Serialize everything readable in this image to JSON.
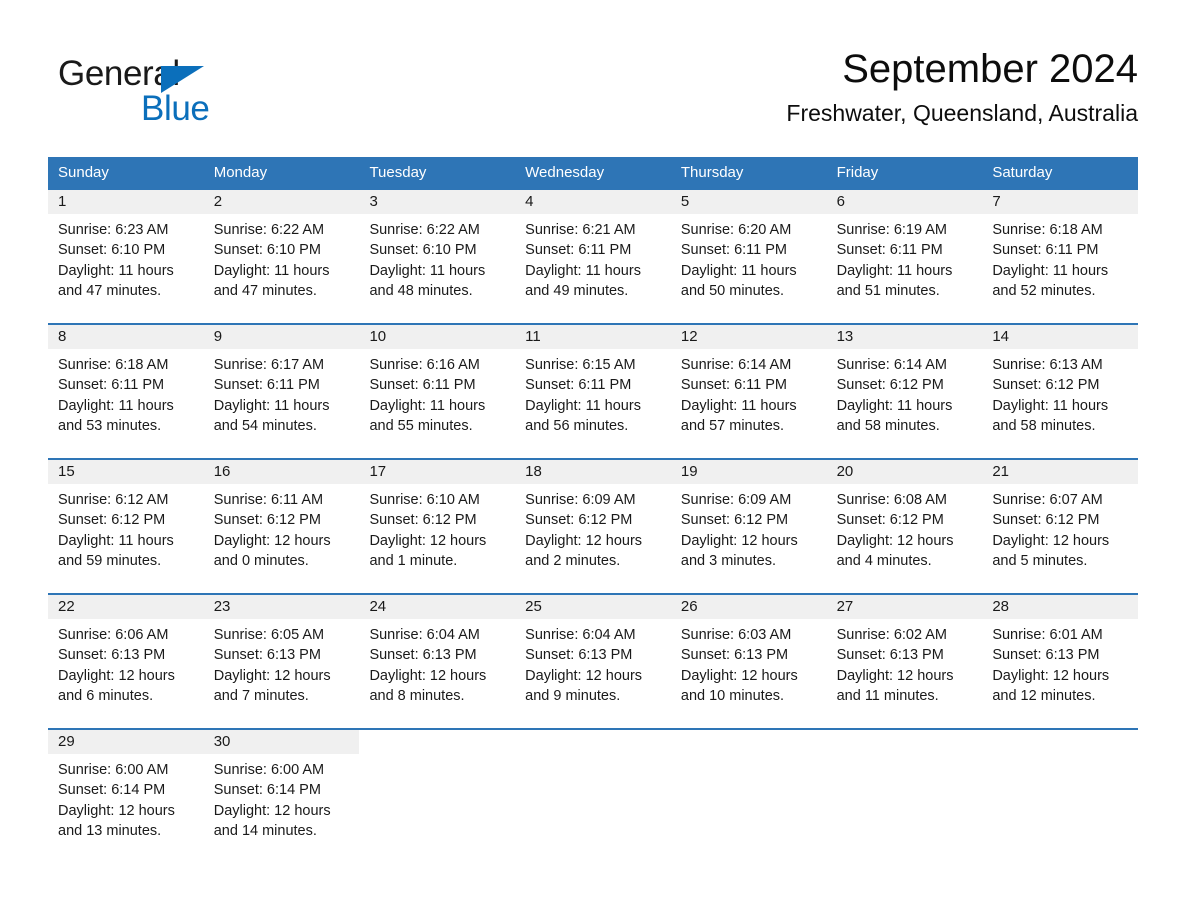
{
  "brand": {
    "name_part1": "General",
    "name_part2": "Blue",
    "triangle_color": "#0B6FBB"
  },
  "header": {
    "title": "September 2024",
    "subtitle": "Freshwater, Queensland, Australia"
  },
  "theme": {
    "header_blue": "#2E75B6",
    "daynum_band": "#F0F0F0",
    "text": "#1a1a1a"
  },
  "weekdays": [
    "Sunday",
    "Monday",
    "Tuesday",
    "Wednesday",
    "Thursday",
    "Friday",
    "Saturday"
  ],
  "weeks": [
    [
      {
        "day": "1",
        "sunrise": "Sunrise: 6:23 AM",
        "sunset": "Sunset: 6:10 PM",
        "daylight_1": "Daylight: 11 hours",
        "daylight_2": "and 47 minutes."
      },
      {
        "day": "2",
        "sunrise": "Sunrise: 6:22 AM",
        "sunset": "Sunset: 6:10 PM",
        "daylight_1": "Daylight: 11 hours",
        "daylight_2": "and 47 minutes."
      },
      {
        "day": "3",
        "sunrise": "Sunrise: 6:22 AM",
        "sunset": "Sunset: 6:10 PM",
        "daylight_1": "Daylight: 11 hours",
        "daylight_2": "and 48 minutes."
      },
      {
        "day": "4",
        "sunrise": "Sunrise: 6:21 AM",
        "sunset": "Sunset: 6:11 PM",
        "daylight_1": "Daylight: 11 hours",
        "daylight_2": "and 49 minutes."
      },
      {
        "day": "5",
        "sunrise": "Sunrise: 6:20 AM",
        "sunset": "Sunset: 6:11 PM",
        "daylight_1": "Daylight: 11 hours",
        "daylight_2": "and 50 minutes."
      },
      {
        "day": "6",
        "sunrise": "Sunrise: 6:19 AM",
        "sunset": "Sunset: 6:11 PM",
        "daylight_1": "Daylight: 11 hours",
        "daylight_2": "and 51 minutes."
      },
      {
        "day": "7",
        "sunrise": "Sunrise: 6:18 AM",
        "sunset": "Sunset: 6:11 PM",
        "daylight_1": "Daylight: 11 hours",
        "daylight_2": "and 52 minutes."
      }
    ],
    [
      {
        "day": "8",
        "sunrise": "Sunrise: 6:18 AM",
        "sunset": "Sunset: 6:11 PM",
        "daylight_1": "Daylight: 11 hours",
        "daylight_2": "and 53 minutes."
      },
      {
        "day": "9",
        "sunrise": "Sunrise: 6:17 AM",
        "sunset": "Sunset: 6:11 PM",
        "daylight_1": "Daylight: 11 hours",
        "daylight_2": "and 54 minutes."
      },
      {
        "day": "10",
        "sunrise": "Sunrise: 6:16 AM",
        "sunset": "Sunset: 6:11 PM",
        "daylight_1": "Daylight: 11 hours",
        "daylight_2": "and 55 minutes."
      },
      {
        "day": "11",
        "sunrise": "Sunrise: 6:15 AM",
        "sunset": "Sunset: 6:11 PM",
        "daylight_1": "Daylight: 11 hours",
        "daylight_2": "and 56 minutes."
      },
      {
        "day": "12",
        "sunrise": "Sunrise: 6:14 AM",
        "sunset": "Sunset: 6:11 PM",
        "daylight_1": "Daylight: 11 hours",
        "daylight_2": "and 57 minutes."
      },
      {
        "day": "13",
        "sunrise": "Sunrise: 6:14 AM",
        "sunset": "Sunset: 6:12 PM",
        "daylight_1": "Daylight: 11 hours",
        "daylight_2": "and 58 minutes."
      },
      {
        "day": "14",
        "sunrise": "Sunrise: 6:13 AM",
        "sunset": "Sunset: 6:12 PM",
        "daylight_1": "Daylight: 11 hours",
        "daylight_2": "and 58 minutes."
      }
    ],
    [
      {
        "day": "15",
        "sunrise": "Sunrise: 6:12 AM",
        "sunset": "Sunset: 6:12 PM",
        "daylight_1": "Daylight: 11 hours",
        "daylight_2": "and 59 minutes."
      },
      {
        "day": "16",
        "sunrise": "Sunrise: 6:11 AM",
        "sunset": "Sunset: 6:12 PM",
        "daylight_1": "Daylight: 12 hours",
        "daylight_2": "and 0 minutes."
      },
      {
        "day": "17",
        "sunrise": "Sunrise: 6:10 AM",
        "sunset": "Sunset: 6:12 PM",
        "daylight_1": "Daylight: 12 hours",
        "daylight_2": "and 1 minute."
      },
      {
        "day": "18",
        "sunrise": "Sunrise: 6:09 AM",
        "sunset": "Sunset: 6:12 PM",
        "daylight_1": "Daylight: 12 hours",
        "daylight_2": "and 2 minutes."
      },
      {
        "day": "19",
        "sunrise": "Sunrise: 6:09 AM",
        "sunset": "Sunset: 6:12 PM",
        "daylight_1": "Daylight: 12 hours",
        "daylight_2": "and 3 minutes."
      },
      {
        "day": "20",
        "sunrise": "Sunrise: 6:08 AM",
        "sunset": "Sunset: 6:12 PM",
        "daylight_1": "Daylight: 12 hours",
        "daylight_2": "and 4 minutes."
      },
      {
        "day": "21",
        "sunrise": "Sunrise: 6:07 AM",
        "sunset": "Sunset: 6:12 PM",
        "daylight_1": "Daylight: 12 hours",
        "daylight_2": "and 5 minutes."
      }
    ],
    [
      {
        "day": "22",
        "sunrise": "Sunrise: 6:06 AM",
        "sunset": "Sunset: 6:13 PM",
        "daylight_1": "Daylight: 12 hours",
        "daylight_2": "and 6 minutes."
      },
      {
        "day": "23",
        "sunrise": "Sunrise: 6:05 AM",
        "sunset": "Sunset: 6:13 PM",
        "daylight_1": "Daylight: 12 hours",
        "daylight_2": "and 7 minutes."
      },
      {
        "day": "24",
        "sunrise": "Sunrise: 6:04 AM",
        "sunset": "Sunset: 6:13 PM",
        "daylight_1": "Daylight: 12 hours",
        "daylight_2": "and 8 minutes."
      },
      {
        "day": "25",
        "sunrise": "Sunrise: 6:04 AM",
        "sunset": "Sunset: 6:13 PM",
        "daylight_1": "Daylight: 12 hours",
        "daylight_2": "and 9 minutes."
      },
      {
        "day": "26",
        "sunrise": "Sunrise: 6:03 AM",
        "sunset": "Sunset: 6:13 PM",
        "daylight_1": "Daylight: 12 hours",
        "daylight_2": "and 10 minutes."
      },
      {
        "day": "27",
        "sunrise": "Sunrise: 6:02 AM",
        "sunset": "Sunset: 6:13 PM",
        "daylight_1": "Daylight: 12 hours",
        "daylight_2": "and 11 minutes."
      },
      {
        "day": "28",
        "sunrise": "Sunrise: 6:01 AM",
        "sunset": "Sunset: 6:13 PM",
        "daylight_1": "Daylight: 12 hours",
        "daylight_2": "and 12 minutes."
      }
    ],
    [
      {
        "day": "29",
        "sunrise": "Sunrise: 6:00 AM",
        "sunset": "Sunset: 6:14 PM",
        "daylight_1": "Daylight: 12 hours",
        "daylight_2": "and 13 minutes."
      },
      {
        "day": "30",
        "sunrise": "Sunrise: 6:00 AM",
        "sunset": "Sunset: 6:14 PM",
        "daylight_1": "Daylight: 12 hours",
        "daylight_2": "and 14 minutes."
      },
      {
        "day": "",
        "sunrise": "",
        "sunset": "",
        "daylight_1": "",
        "daylight_2": ""
      },
      {
        "day": "",
        "sunrise": "",
        "sunset": "",
        "daylight_1": "",
        "daylight_2": ""
      },
      {
        "day": "",
        "sunrise": "",
        "sunset": "",
        "daylight_1": "",
        "daylight_2": ""
      },
      {
        "day": "",
        "sunrise": "",
        "sunset": "",
        "daylight_1": "",
        "daylight_2": ""
      },
      {
        "day": "",
        "sunrise": "",
        "sunset": "",
        "daylight_1": "",
        "daylight_2": ""
      }
    ]
  ]
}
